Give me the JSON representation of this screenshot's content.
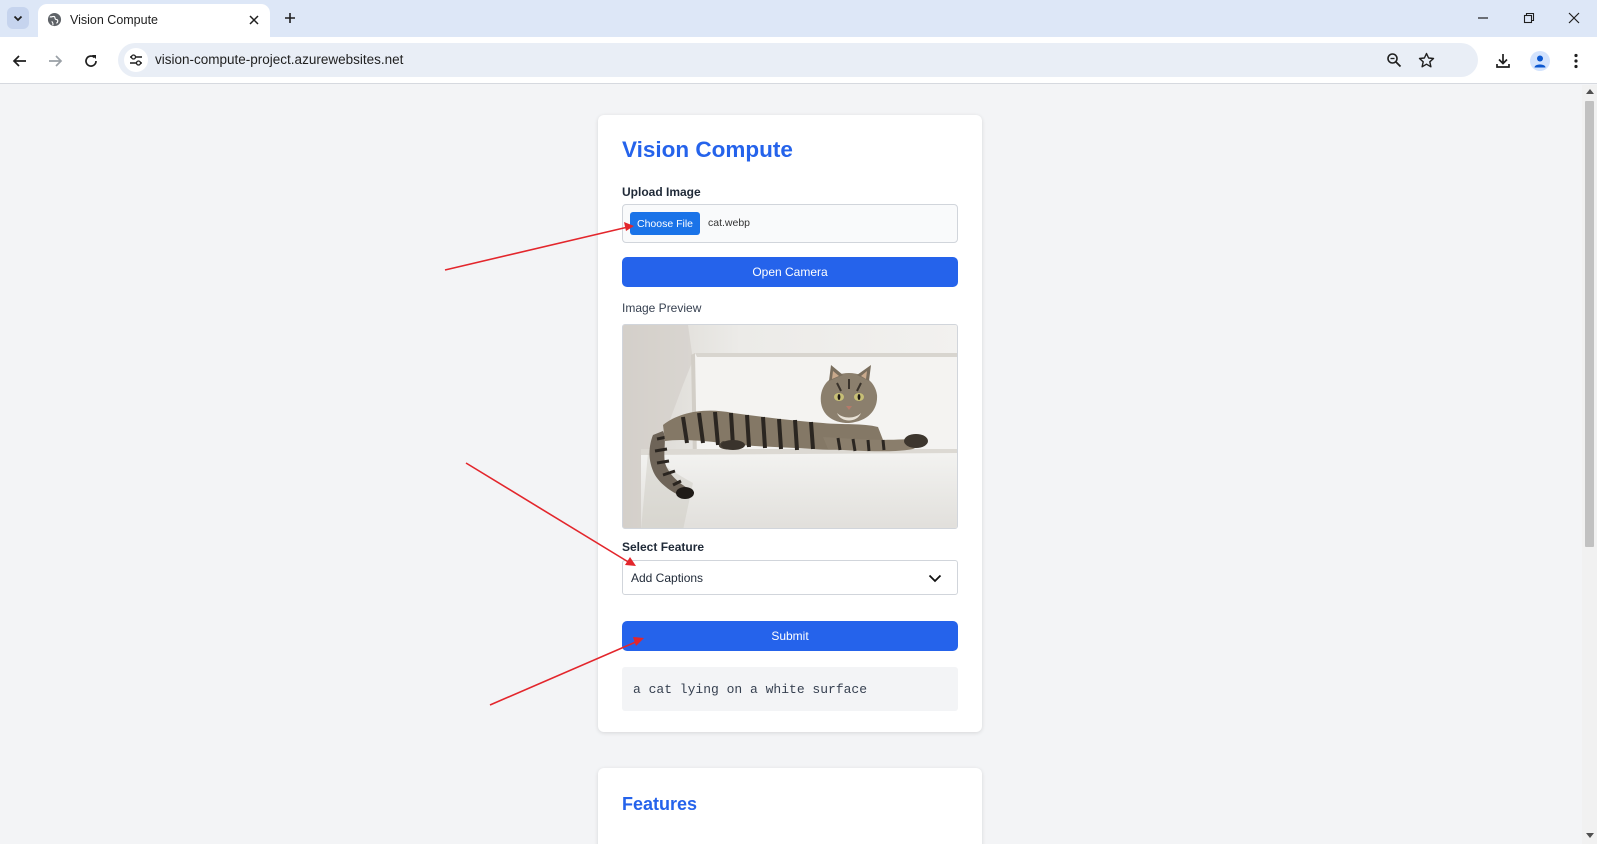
{
  "browser": {
    "tab_title": "Vision Compute",
    "url": "vision-compute-project.azurewebsites.net"
  },
  "app": {
    "title": "Vision Compute",
    "upload_label": "Upload Image",
    "choose_file_label": "Choose File",
    "file_name": "cat.webp",
    "open_camera_label": "Open Camera",
    "preview_label": "Image Preview",
    "select_label": "Select Feature",
    "selected_feature": "Add Captions",
    "submit_label": "Submit",
    "result_text": "a cat lying on a white surface"
  },
  "features": {
    "title": "Features"
  },
  "colors": {
    "accent": "#2563eb",
    "choose_file": "#1a73e8",
    "annotation_arrow": "#e3262c"
  }
}
